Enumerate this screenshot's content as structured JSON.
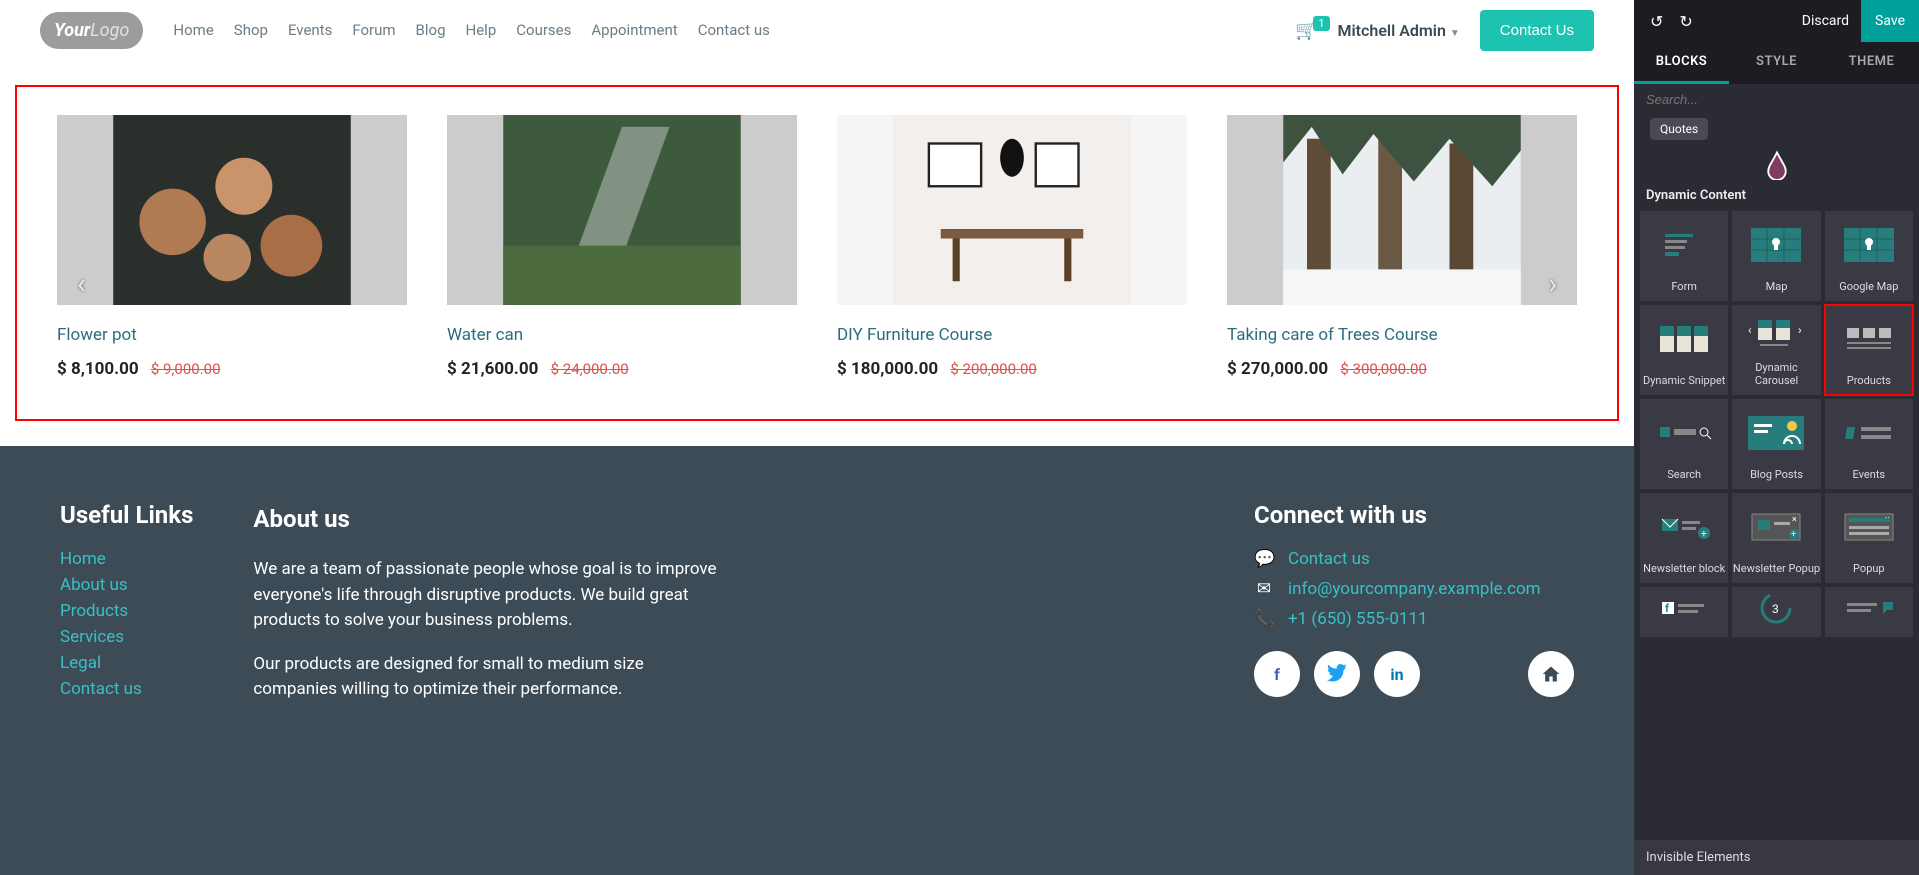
{
  "nav": {
    "items": [
      "Home",
      "Shop",
      "Events",
      "Forum",
      "Blog",
      "Help",
      "Courses",
      "Appointment",
      "Contact us"
    ],
    "cart_count": "1",
    "user": "Mitchell Admin",
    "contact_btn": "Contact Us"
  },
  "products": [
    {
      "title": "Flower pot",
      "price": "$ 8,100.00",
      "old": "$ 9,000.00"
    },
    {
      "title": "Water can",
      "price": "$ 21,600.00",
      "old": "$ 24,000.00"
    },
    {
      "title": "DIY Furniture Course",
      "price": "$ 180,000.00",
      "old": "$ 200,000.00"
    },
    {
      "title": "Taking care of Trees Course",
      "price": "$ 270,000.00",
      "old": "$ 300,000.00"
    }
  ],
  "footer": {
    "useful_heading": "Useful Links",
    "links": [
      "Home",
      "About us",
      "Products",
      "Services",
      "Legal",
      "Contact us"
    ],
    "about_heading": "About us",
    "about_p1": "We are a team of passionate people whose goal is to improve everyone's life through disruptive products. We build great products to solve your business problems.",
    "about_p2": "Our products are designed for small to medium size companies willing to optimize their performance.",
    "connect_heading": "Connect with us",
    "contact": "Contact us",
    "email": "info@yourcompany.example.com",
    "phone": "+1 (650) 555-0111"
  },
  "editor": {
    "discard": "Discard",
    "save": "Save",
    "tabs": [
      "BLOCKS",
      "STYLE",
      "THEME"
    ],
    "search_placeholder": "Search...",
    "pill": "Quotes",
    "section": "Dynamic Content",
    "tiles": [
      {
        "label": "Form"
      },
      {
        "label": "Map"
      },
      {
        "label": "Google Map"
      },
      {
        "label": "Dynamic Snippet"
      },
      {
        "label": "Dynamic Carousel"
      },
      {
        "label": "Products"
      },
      {
        "label": "Search"
      },
      {
        "label": "Blog Posts"
      },
      {
        "label": "Events"
      },
      {
        "label": "Newsletter block"
      },
      {
        "label": "Newsletter Popup"
      },
      {
        "label": "Popup"
      },
      {
        "label": ""
      },
      {
        "label": ""
      },
      {
        "label": ""
      }
    ],
    "invisible": "Invisible Elements"
  }
}
